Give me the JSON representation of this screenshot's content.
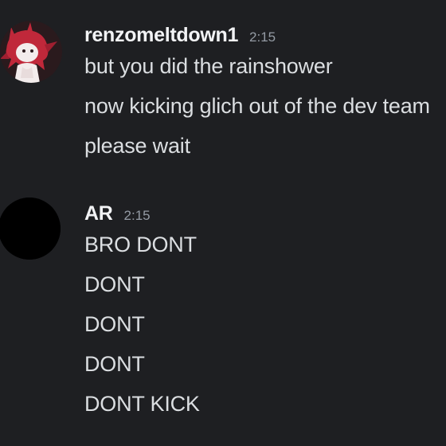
{
  "messages": [
    {
      "author": "renzomeltdown1",
      "time": "2:15",
      "avatar_icon": "fox-character-avatar",
      "lines": [
        "but you did the rainshower",
        "now kicking glich out of the dev team",
        "please wait"
      ]
    },
    {
      "author": "AR",
      "time": "2:15",
      "avatar_icon": "black-circle-avatar",
      "lines": [
        "BRO DONT",
        "DONT",
        "DONT",
        "DONT",
        "DONT KICK"
      ]
    }
  ],
  "colors": {
    "background": "#1e1f22",
    "username": "#f2f3f5",
    "text": "#dbdee1",
    "timestamp": "#949ba4",
    "avatar_red": "#c0283a"
  }
}
